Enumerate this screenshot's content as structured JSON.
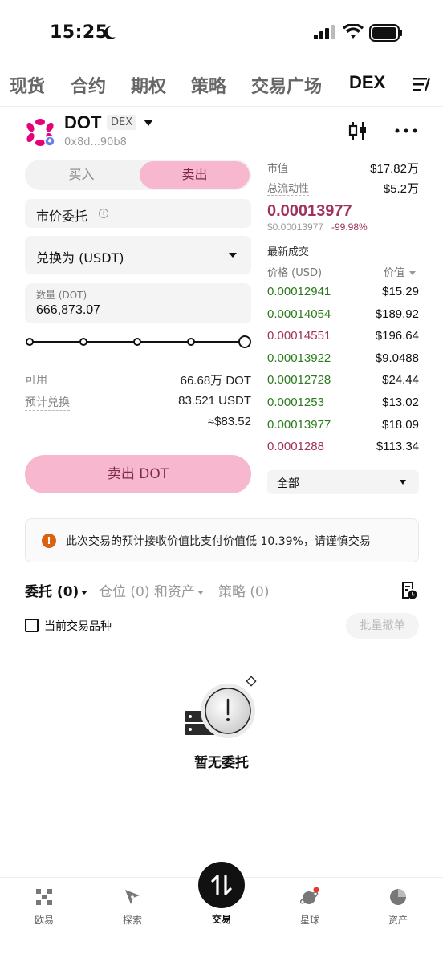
{
  "status_bar": {
    "time": "15:25"
  },
  "top_tabs": [
    "现货",
    "合约",
    "期权",
    "策略",
    "交易广场",
    "DEX"
  ],
  "token": {
    "name": "DOT",
    "badge": "DEX",
    "address": "0x8d...90b8"
  },
  "trade_form": {
    "buy_label": "买入",
    "sell_label": "卖出",
    "order_type": "市价委托",
    "swap_to": "兑换为 (USDT)",
    "quantity_label": "数量 (DOT)",
    "quantity_value": "666,873.07",
    "slider_fraction": 1.0,
    "available_label": "可用",
    "available_value": "66.68万 DOT",
    "est_label": "预计兑换",
    "est_value": "83.521 USDT",
    "est_usd": "≈$83.52",
    "submit_label": "卖出 DOT"
  },
  "market": {
    "mcap_label": "市值",
    "mcap_value": "$17.82万",
    "liq_label": "总流动性",
    "liq_value": "$5.2万",
    "price": "0.00013977",
    "price_usd": "$0.00013977",
    "change": "-99.98%",
    "trades_title": "最新成交",
    "col_price": "价格 (USD)",
    "col_value": "价值",
    "trades": [
      {
        "price": "0.00012941",
        "value": "$15.29",
        "side": "up"
      },
      {
        "price": "0.00014054",
        "value": "$189.92",
        "side": "up"
      },
      {
        "price": "0.00014551",
        "value": "$196.64",
        "side": "down"
      },
      {
        "price": "0.00013922",
        "value": "$9.0488",
        "side": "up"
      },
      {
        "price": "0.00012728",
        "value": "$24.44",
        "side": "up"
      },
      {
        "price": "0.0001253",
        "value": "$13.02",
        "side": "up"
      },
      {
        "price": "0.00013977",
        "value": "$18.09",
        "side": "up"
      },
      {
        "price": "0.0001288",
        "value": "$113.34",
        "side": "down"
      }
    ],
    "filter": "全部"
  },
  "warning": "此次交易的预计接收价值比支付价值低 10.39%，请谨慎交易",
  "orders": {
    "tabs": [
      "委托 (0)",
      "仓位 (0) 和资产",
      "策略 (0)"
    ],
    "current_pair_label": "当前交易品种",
    "batch_cancel": "批量撤单",
    "empty_text": "暂无委托"
  },
  "bottom_nav": [
    "欧易",
    "探索",
    "交易",
    "星球",
    "资产"
  ],
  "colors": {
    "sell_pink": "#f7b8cf",
    "sell_text": "#7d2a4a",
    "price_red": "#a0315c",
    "up_green": "#2b7a1e",
    "warn_orange": "#d9620f"
  }
}
